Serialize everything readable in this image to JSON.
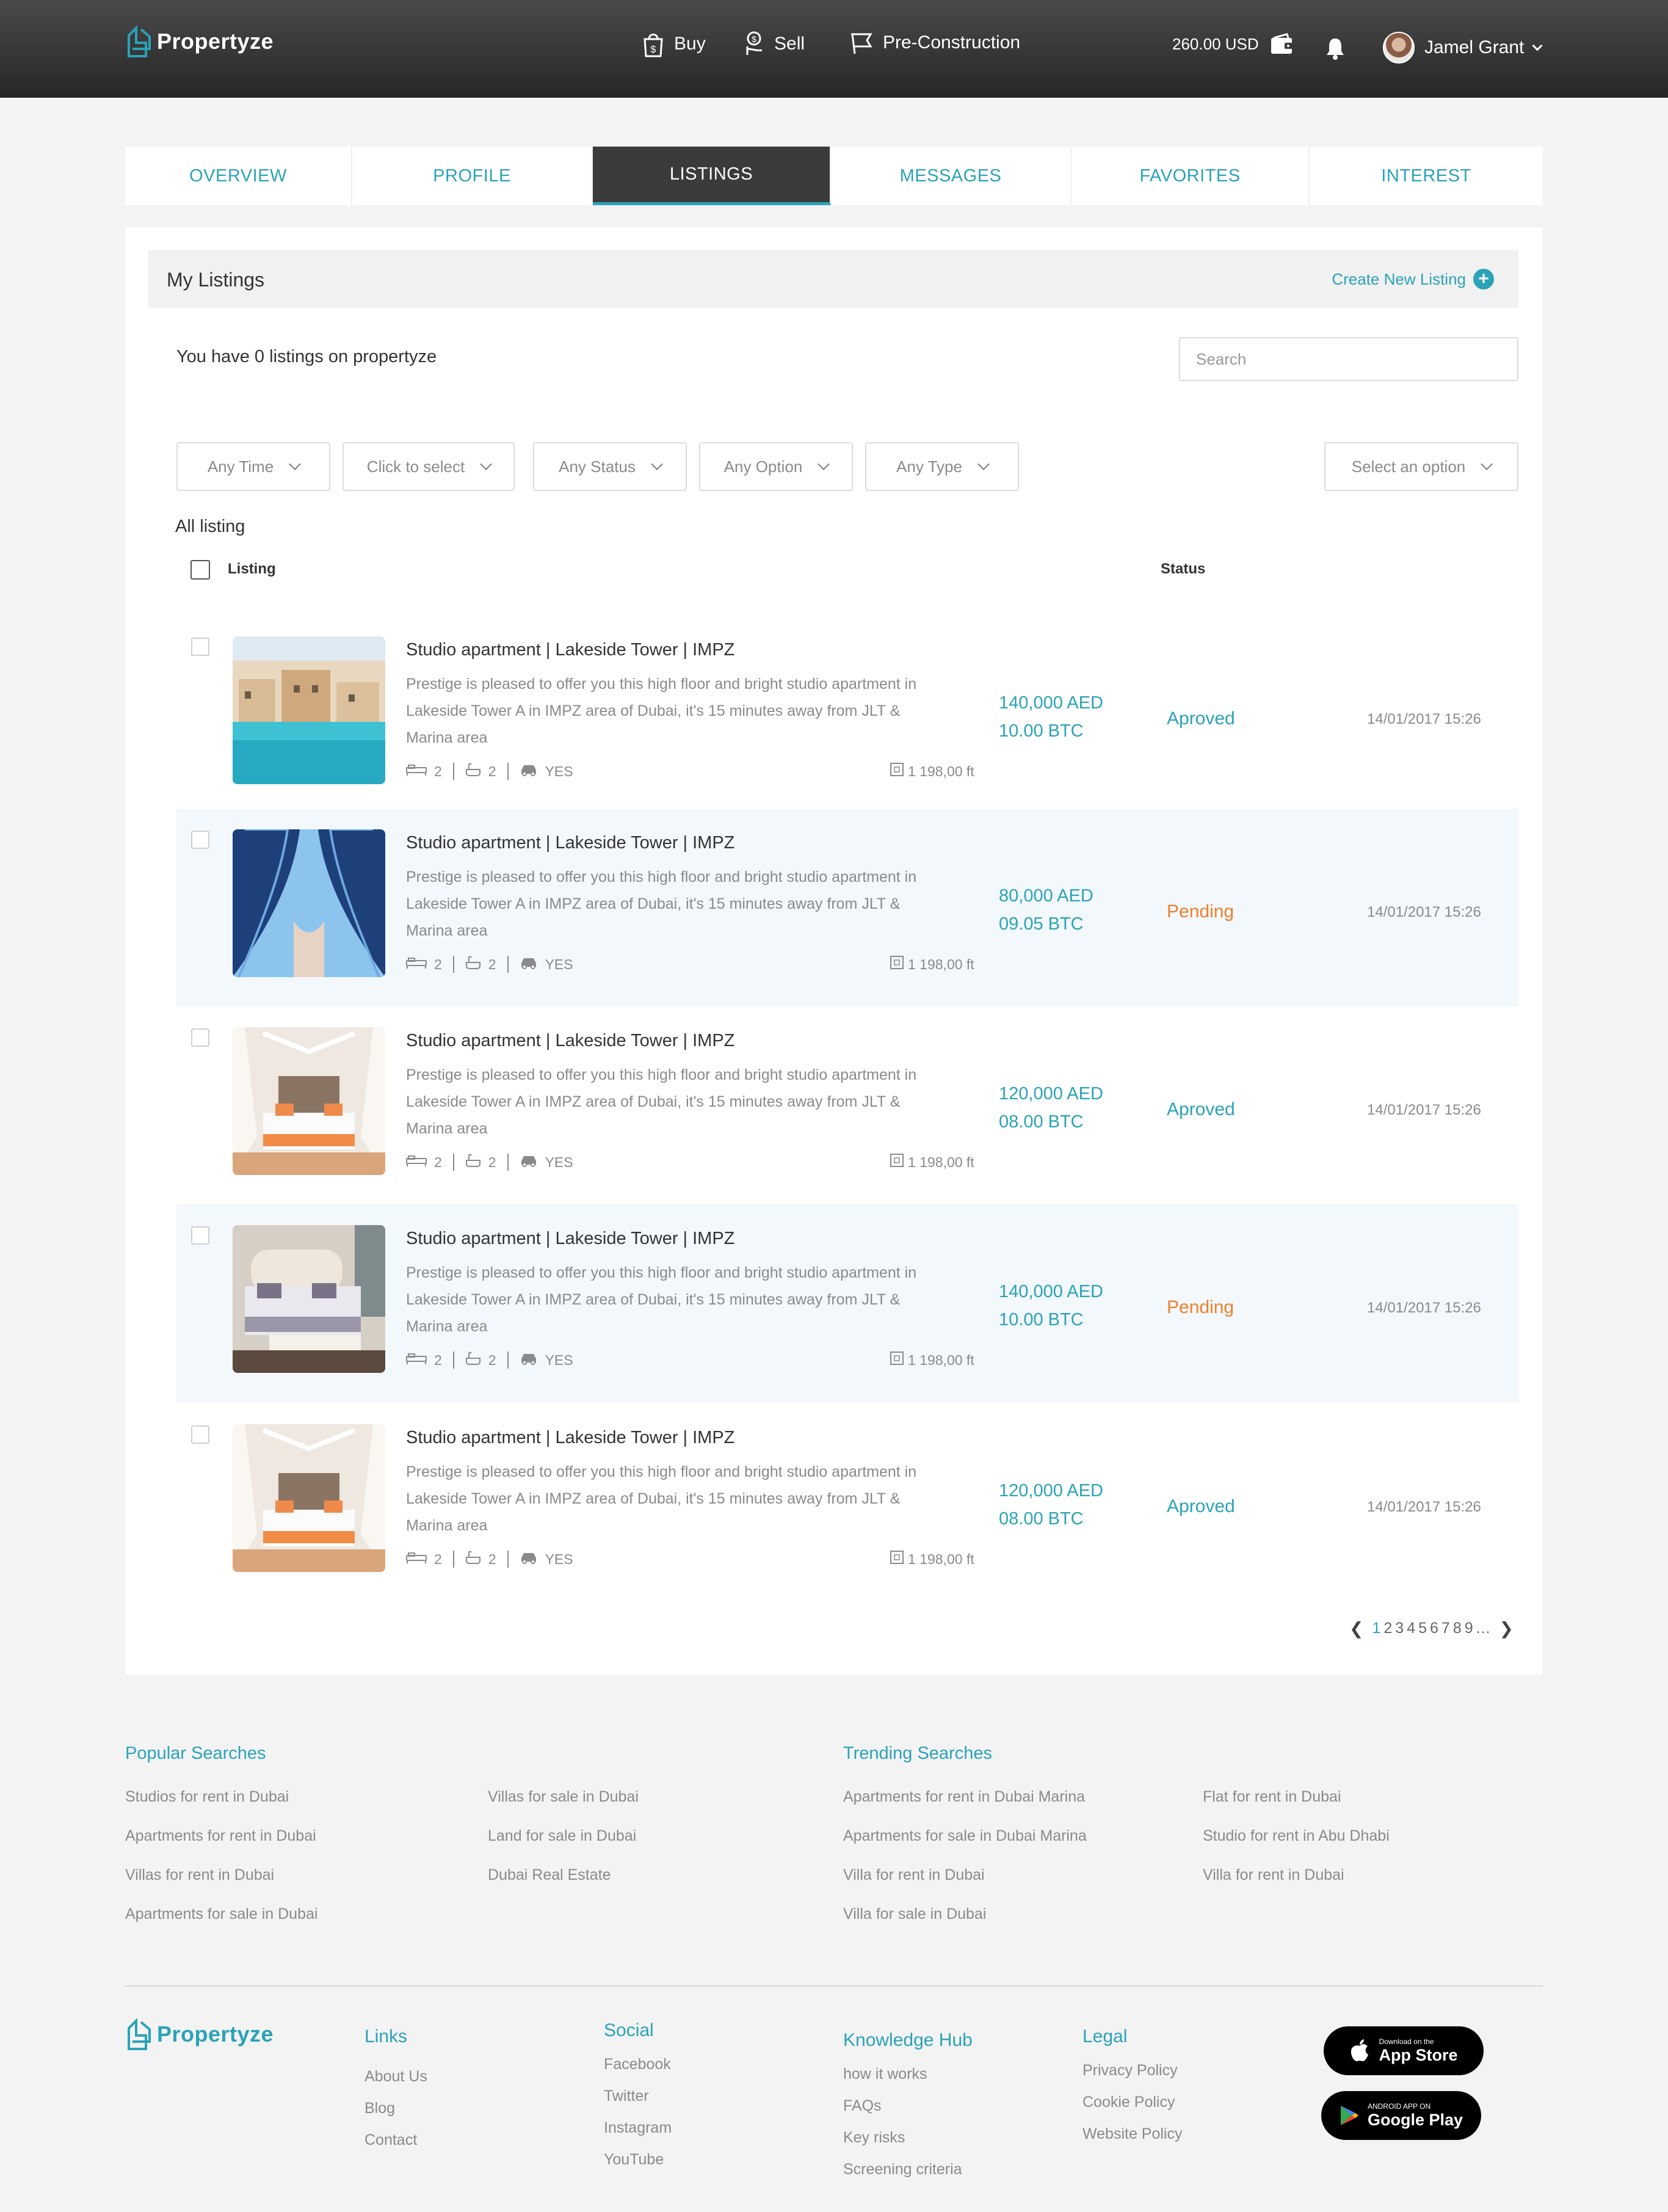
{
  "brand": {
    "name": "Propertyze"
  },
  "nav": [
    {
      "label": "Buy",
      "icon": "shopping-bag-dollar-icon"
    },
    {
      "label": "Sell",
      "icon": "hand-coin-icon"
    },
    {
      "label": "Pre-Construction",
      "icon": "flag-icon"
    }
  ],
  "wallet": {
    "balance": "260.00 USD",
    "icon": "wallet-icon"
  },
  "notifications": {
    "icon": "bell-icon"
  },
  "user": {
    "name": "Jamel Grant"
  },
  "tabs": [
    {
      "label": "OVERVIEW",
      "active": false
    },
    {
      "label": "PROFILE",
      "active": false
    },
    {
      "label": "LISTINGS",
      "active": true
    },
    {
      "label": "MESSAGES",
      "active": false
    },
    {
      "label": "FAVORITES",
      "active": false
    },
    {
      "label": "INTEREST",
      "active": false
    }
  ],
  "listings_page": {
    "title": "My Listings",
    "create_label": "Create New Listing",
    "count_text": "You have 0 listings on propertyze",
    "search_placeholder": "Search",
    "filters": [
      "Any Time",
      "Click to select",
      "Any Status",
      "Any Option",
      "Any Type"
    ],
    "sort_select": "Select an option",
    "all_listing_label": "All listing",
    "column_listing": "Listing",
    "column_status": "Status"
  },
  "listings": [
    {
      "title": "Studio apartment | Lakeside Tower | IMPZ",
      "description": "Prestige is pleased to offer you this high floor and bright studio apartment in Lakeside Tower A in IMPZ area of Dubai, it's 15 minutes away from JLT & Marina area",
      "bedrooms": "2",
      "bathrooms": "2",
      "parking": "YES",
      "area": "1 198,00 ft",
      "price_aed": "140,000 AED",
      "price_btc": "10.00 BTC",
      "status": "Aproved",
      "status_kind": "approved",
      "date": "14/01/2017  15:26",
      "image": "pool-resort-photo"
    },
    {
      "title": "Studio apartment | Lakeside Tower | IMPZ",
      "description": "Prestige is pleased to offer you this high floor and bright studio apartment in Lakeside Tower A in IMPZ area of Dubai, it's 15 minutes away from JLT & Marina area",
      "bedrooms": "2",
      "bathrooms": "2",
      "parking": "YES",
      "area": "1 198,00 ft",
      "price_aed": "80,000 AED",
      "price_btc": "09.05 BTC",
      "status": "Pending",
      "status_kind": "pending",
      "date": "14/01/2017  15:26",
      "image": "tower-facade-photo"
    },
    {
      "title": "Studio apartment | Lakeside Tower | IMPZ",
      "description": "Prestige is pleased to offer you this high floor and bright studio apartment in Lakeside Tower A in IMPZ area of Dubai, it's 15 minutes away from JLT & Marina area",
      "bedrooms": "2",
      "bathrooms": "2",
      "parking": "YES",
      "area": "1 198,00 ft",
      "price_aed": "120,000 AED",
      "price_btc": "08.00 BTC",
      "status": "Aproved",
      "status_kind": "approved",
      "date": "14/01/2017  15:26",
      "image": "canopy-bedroom-photo"
    },
    {
      "title": "Studio apartment | Lakeside Tower | IMPZ",
      "description": "Prestige is pleased to offer you this high floor and bright studio apartment in Lakeside Tower A in IMPZ area of Dubai, it's 15 minutes away from JLT & Marina area",
      "bedrooms": "2",
      "bathrooms": "2",
      "parking": "YES",
      "area": "1 198,00 ft",
      "price_aed": "140,000 AED",
      "price_btc": "10.00 BTC",
      "status": "Pending",
      "status_kind": "pending",
      "date": "14/01/2017  15:26",
      "image": "hotel-bedroom-photo"
    },
    {
      "title": "Studio apartment | Lakeside Tower | IMPZ",
      "description": "Prestige is pleased to offer you this high floor and bright studio apartment in Lakeside Tower A in IMPZ area of Dubai, it's 15 minutes away from JLT & Marina area",
      "bedrooms": "2",
      "bathrooms": "2",
      "parking": "YES",
      "area": "1 198,00 ft",
      "price_aed": "120,000 AED",
      "price_btc": "08.00 BTC",
      "status": "Aproved",
      "status_kind": "approved",
      "date": "14/01/2017  15:26",
      "image": "canopy-bedroom-photo"
    }
  ],
  "pagination": {
    "current": "1",
    "pages": [
      "1",
      "2",
      "3",
      "4",
      "5",
      "6",
      "7",
      "8",
      "9"
    ],
    "ellipsis": "..."
  },
  "popular_searches": {
    "title": "Popular Searches",
    "col1": [
      "Studios for rent in Dubai",
      "Apartments for rent in Dubai",
      "Villas for rent in Dubai",
      "Apartments for sale in Dubai"
    ],
    "col2": [
      "Villas for sale in Dubai",
      "Land for sale in Dubai",
      "Dubai Real Estate"
    ]
  },
  "trending_searches": {
    "title": "Trending Searches",
    "col1": [
      "Apartments for rent in Dubai Marina",
      "Apartments for sale in Dubai Marina",
      "Villa for rent in Dubai",
      "Villa for sale in Dubai"
    ],
    "col2": [
      "Flat for rent in Dubai",
      "Studio for rent in Abu Dhabi",
      "Villa for rent in Dubai"
    ]
  },
  "footer": {
    "links": {
      "title": "Links",
      "items": [
        "About Us",
        "Blog",
        "Contact"
      ]
    },
    "social": {
      "title": "Social",
      "items": [
        "Facebook",
        "Twitter",
        "Instagram",
        "YouTube"
      ]
    },
    "knowledge": {
      "title": "Knowledge Hub",
      "items": [
        "how it works",
        "FAQs",
        "Key risks",
        "Screening criteria"
      ]
    },
    "legal": {
      "title": "Legal",
      "items": [
        "Privacy Policy",
        "Cookie Policy",
        "Website Policy"
      ]
    },
    "app_store": {
      "small": "Download on the",
      "big": "App Store"
    },
    "google_play": {
      "small": "ANDROID APP ON",
      "big": "Google Play"
    }
  },
  "colors": {
    "accent": "#2aa3b8",
    "pending": "#f07f2b",
    "header_dark": "#262626",
    "active_tab": "#3b3b3b"
  }
}
